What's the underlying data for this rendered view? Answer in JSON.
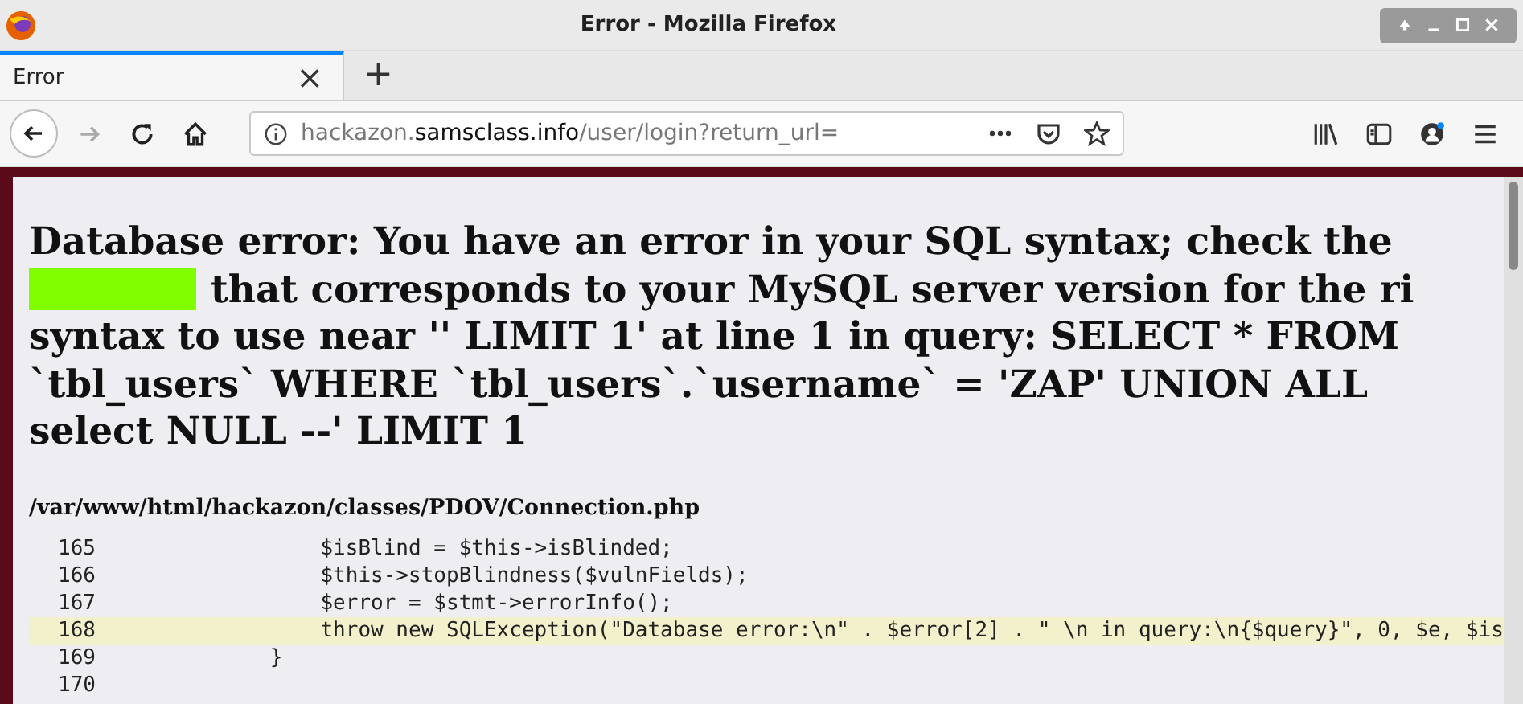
{
  "window": {
    "title": "Error - Mozilla Firefox"
  },
  "tabs": [
    {
      "label": "Error",
      "selected": true,
      "close": "×"
    }
  ],
  "new_tab": "+",
  "address_bar": {
    "host_prefix": "hackazon.",
    "domain": "samsclass.info",
    "path": "/user/login?return_url="
  },
  "page": {
    "error_lines": [
      {
        "text": "Database error: You have an error in your SQL syntax; check the",
        "redacted_prefix": false
      },
      {
        "text": "that corresponds to your MySQL server version for the ri",
        "redacted_prefix": true
      },
      {
        "text": "syntax to use near '' LIMIT 1' at line 1 in query: SELECT * FROM",
        "redacted_prefix": false
      },
      {
        "text": "`tbl_users` WHERE `tbl_users`.`username` = 'ZAP' UNION ALL",
        "redacted_prefix": false
      },
      {
        "text": "select NULL --' LIMIT 1",
        "redacted_prefix": false
      }
    ],
    "file_path": "/var/www/html/hackazon/classes/PDOV/Connection.php",
    "code_lines": [
      {
        "number": "165",
        "code": "                $isBlind = $this->isBlinded;",
        "highlighted": false
      },
      {
        "number": "166",
        "code": "                $this->stopBlindness($vulnFields);",
        "highlighted": false
      },
      {
        "number": "167",
        "code": "                $error = $stmt->errorInfo();",
        "highlighted": false
      },
      {
        "number": "168",
        "code": "                throw new SQLException(\"Database error:\\n\" . $error[2] . \" \\n in query:\\n{$query}\", 0, $e, $is",
        "highlighted": true
      },
      {
        "number": "169",
        "code": "            }",
        "highlighted": false
      },
      {
        "number": "170",
        "highlighted": false
      }
    ]
  }
}
